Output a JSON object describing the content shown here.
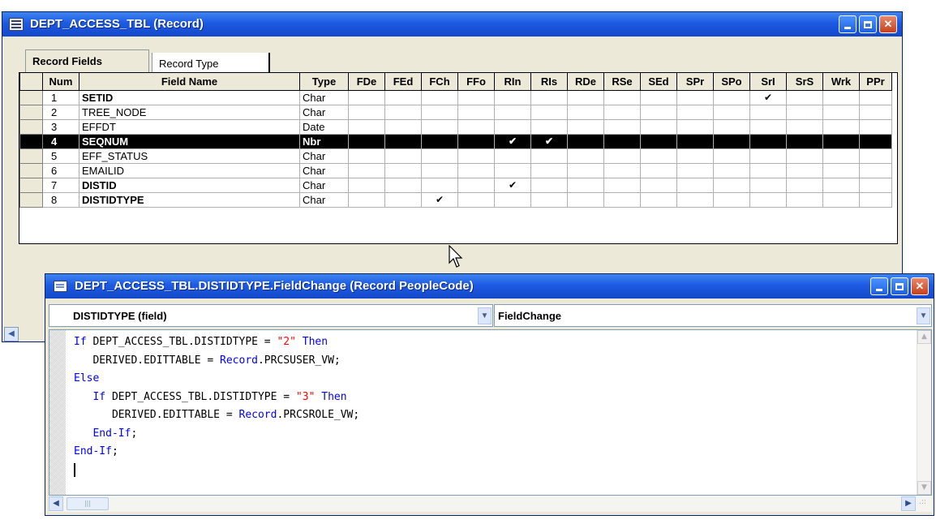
{
  "record_window": {
    "title": "DEPT_ACCESS_TBL (Record)",
    "tabs": [
      {
        "label": "Record Fields",
        "active": true
      },
      {
        "label": "Record Type",
        "active": false
      }
    ],
    "columns": [
      "Num",
      "Field Name",
      "Type",
      "FDe",
      "FEd",
      "FCh",
      "FFo",
      "RIn",
      "RIs",
      "RDe",
      "RSe",
      "SEd",
      "SPr",
      "SPo",
      "SrI",
      "SrS",
      "Wrk",
      "PPr"
    ],
    "rows": [
      {
        "num": "1",
        "name": "SETID",
        "bold": true,
        "type": "Char",
        "checks": [
          "SrI"
        ]
      },
      {
        "num": "2",
        "name": "TREE_NODE",
        "bold": false,
        "type": "Char",
        "checks": []
      },
      {
        "num": "3",
        "name": "EFFDT",
        "bold": false,
        "type": "Date",
        "checks": []
      },
      {
        "num": "4",
        "name": "SEQNUM",
        "bold": true,
        "type": "Nbr",
        "checks": [
          "RIn",
          "RIs"
        ],
        "selected": true
      },
      {
        "num": "5",
        "name": "EFF_STATUS",
        "bold": false,
        "type": "Char",
        "checks": []
      },
      {
        "num": "6",
        "name": "EMAILID",
        "bold": false,
        "type": "Char",
        "checks": []
      },
      {
        "num": "7",
        "name": "DISTID",
        "bold": true,
        "type": "Char",
        "checks": [
          "RIn"
        ]
      },
      {
        "num": "8",
        "name": "DISTIDTYPE",
        "bold": true,
        "type": "Char",
        "checks": [
          "FCh"
        ]
      }
    ],
    "check_glyph": "✔"
  },
  "code_window": {
    "title": "DEPT_ACCESS_TBL.DISTIDTYPE.FieldChange (Record PeopleCode)",
    "field_combo": "DISTIDTYPE   (field)",
    "event_combo": "FieldChange",
    "code_lines": [
      [
        {
          "t": "If",
          "k": "kw"
        },
        {
          "t": " DEPT_ACCESS_TBL.DISTIDTYPE = "
        },
        {
          "t": "\"2\"",
          "k": "str"
        },
        {
          "t": " "
        },
        {
          "t": "Then",
          "k": "kw"
        }
      ],
      [
        {
          "t": "   DERIVED.EDITTABLE = "
        },
        {
          "t": "Record",
          "k": "kw"
        },
        {
          "t": ".PRCSUSER_VW;"
        }
      ],
      [
        {
          "t": "Else",
          "k": "kw"
        }
      ],
      [
        {
          "t": "   "
        },
        {
          "t": "If",
          "k": "kw"
        },
        {
          "t": " DEPT_ACCESS_TBL.DISTIDTYPE = "
        },
        {
          "t": "\"3\"",
          "k": "str"
        },
        {
          "t": " "
        },
        {
          "t": "Then",
          "k": "kw"
        }
      ],
      [
        {
          "t": "      DERIVED.EDITTABLE = "
        },
        {
          "t": "Record",
          "k": "kw"
        },
        {
          "t": ".PRCSROLE_VW;"
        }
      ],
      [
        {
          "t": "   "
        },
        {
          "t": "End-If",
          "k": "kw"
        },
        {
          "t": ";"
        }
      ],
      [
        {
          "t": "End-If",
          "k": "kw"
        },
        {
          "t": ";"
        }
      ],
      [
        {
          "t": "",
          "caret": true
        }
      ]
    ]
  },
  "colors": {
    "titlebar": "#1d5ae3",
    "keyword": "#0000ff",
    "string": "#ff0000",
    "selected_row": "#000000"
  },
  "icons": [
    "record-icon",
    "peoplecode-icon",
    "minimize-icon",
    "maximize-icon",
    "close-icon",
    "dropdown-arrow-icon",
    "scroll-left-icon",
    "scroll-right-icon",
    "scroll-up-icon",
    "scroll-down-icon",
    "checkmark-icon",
    "mouse-cursor-icon"
  ]
}
